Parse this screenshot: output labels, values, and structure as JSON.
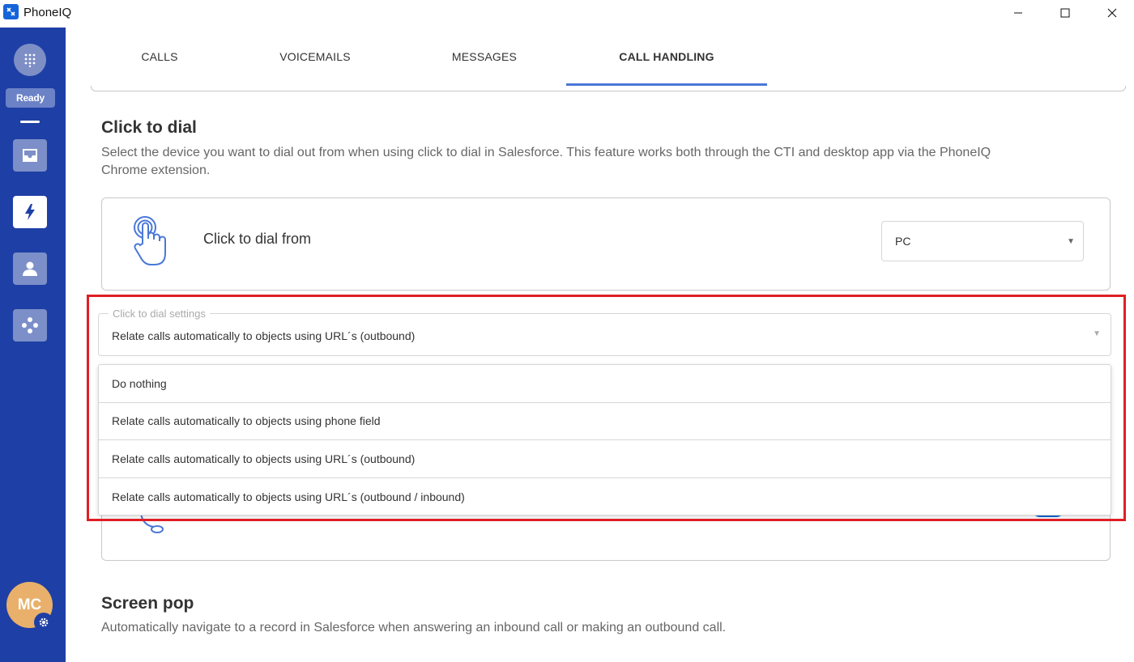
{
  "window": {
    "title": "PhoneIQ"
  },
  "sidebar": {
    "status": "Ready",
    "avatar_initials": "MC",
    "items": [
      {
        "icon": "inbox-icon"
      },
      {
        "icon": "lightning-icon"
      },
      {
        "icon": "contact-icon"
      },
      {
        "icon": "integrations-icon"
      }
    ]
  },
  "tabs": [
    {
      "label": "CALLS"
    },
    {
      "label": "VOICEMAILS"
    },
    {
      "label": "MESSAGES"
    },
    {
      "label": "CALL HANDLING"
    }
  ],
  "click_to_dial": {
    "title": "Click to dial",
    "description": "Select the device you want to dial out from when using click to dial in Salesforce. This feature works both through the CTI and desktop app via the PhoneIQ Chrome extension.",
    "from_label": "Click to dial from",
    "device_value": "PC"
  },
  "settings": {
    "legend": "Click to dial settings",
    "selected": "Relate calls automatically to objects using URL´s (outbound)",
    "options": [
      "Do nothing",
      "Relate calls automatically to objects using phone field",
      "Relate calls automatically to objects using URL´s (outbound)",
      "Relate calls automatically to objects using URL´s (outbound / inbound)"
    ]
  },
  "screen_pop": {
    "title": "Screen pop",
    "description": "Automatically navigate to a record in Salesforce when answering an inbound call or making an outbound call."
  },
  "colors": {
    "sidebar": "#1e3fa5",
    "accent": "#4a78d8",
    "highlight": "#e01e24"
  }
}
